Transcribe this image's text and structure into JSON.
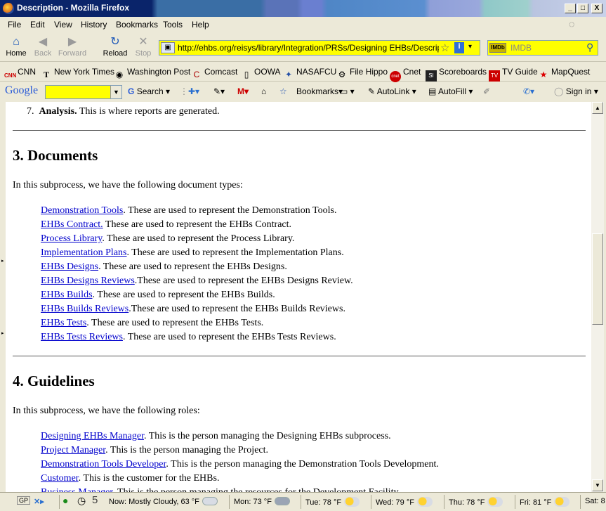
{
  "window": {
    "title": "Description - Mozilla Firefox",
    "minimize": "_",
    "maximize": "□",
    "close": "X"
  },
  "menu": [
    "File",
    "Edit",
    "View",
    "History",
    "Bookmarks",
    "Tools",
    "Help"
  ],
  "nav": {
    "home": "Home",
    "back": "Back",
    "forward": "Forward",
    "reload": "Reload",
    "stop": "Stop",
    "url": "http://ehbs.org/reisys/library/Integration/PRSs/Designing EHBs/Description.h",
    "search_placeholder": "IMDB",
    "search_engine": "IMDb"
  },
  "bookmarks": [
    "CNN",
    "New York Times",
    "Washington Post",
    "Comcast",
    "OOWA",
    "NASAFCU",
    "File Hippo",
    "Cnet",
    "Scoreboards",
    "TV Guide",
    "MapQuest"
  ],
  "google_toolbar": {
    "logo": "Google",
    "search": "Search",
    "bookmarks": "Bookmarks",
    "autolink": "AutoLink",
    "autofill": "AutoFill",
    "signin": "Sign in"
  },
  "content": {
    "list_item_7_num": "7.",
    "list_item_7_bold": "Analysis.",
    "list_item_7_text": " This is where reports are generated.",
    "section3_heading": "3. Documents",
    "section3_intro": "In this subprocess, we have the following document types:",
    "documents": [
      {
        "link": "Demonstration Tools",
        "text": ". These are used to represent the Demonstration Tools."
      },
      {
        "link": "EHBs Contract.",
        "text": " These are used to represent the EHBs Contract."
      },
      {
        "link": "Process Library",
        "text": ". These are used to represent the Process Library."
      },
      {
        "link": "Implementation Plans",
        "text": ". These are used to represent the Implementation Plans."
      },
      {
        "link": "EHBs Designs",
        "text": ". These are used to represent the EHBs Designs."
      },
      {
        "link": "EHBs Designs Reviews",
        "text": ".These are used to represent the EHBs Designs Review."
      },
      {
        "link": "EHBs Builds",
        "text": ". These are used to represent the EHBs Builds."
      },
      {
        "link": "EHBs Builds Reviews",
        "text": ".These are used to represent the EHBs Builds Reviews."
      },
      {
        "link": "EHBs Tests",
        "text": ". These are used to represent the EHBs Tests."
      },
      {
        "link": "EHBs Tests Reviews",
        "text": ". These are used to represent the EHBs Tests Reviews."
      }
    ],
    "section4_heading": "4. Guidelines",
    "section4_intro": "In this subprocess, we have the following roles:",
    "roles": [
      {
        "link": "Designing EHBs Manager",
        "text": ". This is the person managing the Designing EHBs subprocess."
      },
      {
        "link": "Project Manager",
        "text": ". This is the person managing the Project."
      },
      {
        "link": "Demonstration Tools Developer",
        "text": ". This is the person managing the Demonstration Tools Development."
      },
      {
        "link": "Customer",
        "text": ". This is the customer for the EHBs."
      },
      {
        "link": "Business Manager",
        "text": ". This is the person managing the resources for the Development Facility."
      }
    ]
  },
  "status": {
    "gp": "GP",
    "num": "5",
    "now": "Now: Mostly Cloudy, 63 °F",
    "mon": "Mon: 73 °F",
    "tue": "Tue: 78 °F",
    "wed": "Wed: 79 °F",
    "thu": "Thu: 78 °F",
    "fri": "Fri: 81 °F",
    "sat": "Sat: 8"
  },
  "colors": {
    "link": "#0000cc",
    "highlight_field": "#ffff00",
    "chrome": "#ece9d8"
  }
}
